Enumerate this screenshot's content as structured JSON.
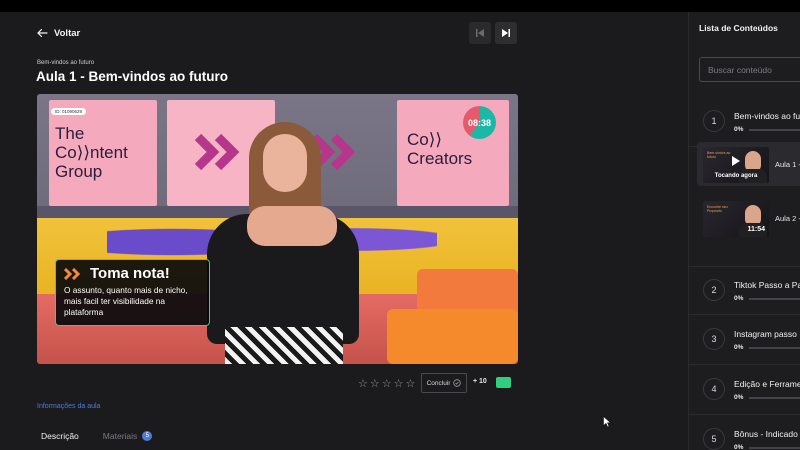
{
  "header": {
    "back_label": "Voltar",
    "breadcrumb": "Bem-vindos ao futuro",
    "title": "Aula 1 - Bem-vindos ao futuro"
  },
  "video": {
    "logo_left_line1": "The",
    "logo_left_line2": "Co⟩⟩ntent",
    "logo_left_line3": "Group",
    "logo_right_line1": "Co⟩⟩",
    "logo_right_line2": "Creators",
    "id_badge": "ID: 01090629",
    "timer": "08:38",
    "tip_title": "Toma nota!",
    "tip_body": "O assunto, quanto mais de nicho, mais facil ter visibilidade na plataforma"
  },
  "actions": {
    "conclude_label": "Concluir",
    "points": "+ 10",
    "rating_stars": 5
  },
  "info_link": "Informações da aula",
  "tabs": [
    {
      "label": "Descrição"
    },
    {
      "label": "Materiais",
      "count": "5"
    }
  ],
  "sidebar": {
    "title": "Lista de Conteúdos",
    "search_placeholder": "Buscar conteúdo",
    "modules": [
      {
        "num": "1",
        "name": "Bem-vindos ao fu",
        "pct": "0%"
      },
      {
        "num": "2",
        "name": "Tiktok Passo a Pa",
        "pct": "0%"
      },
      {
        "num": "3",
        "name": "Instagram passo",
        "pct": "0%"
      },
      {
        "num": "4",
        "name": "Edição e Ferrame",
        "pct": "0%"
      },
      {
        "num": "5",
        "name": "Bônus - Indicado",
        "pct": "0%"
      }
    ],
    "lessons": [
      {
        "name": "Aula 1 -",
        "thumb_label": "Tocando agora",
        "thumb_small": "Bem-vindos ao futuro",
        "current": true
      },
      {
        "name": "Aula 2 -",
        "thumb_duration": "11:54",
        "thumb_small": "Encontre seu Propósito",
        "current": false
      }
    ]
  },
  "colors": {
    "background": "#1b1b1d",
    "accent_link": "#4f7bd9",
    "tip_border": "#2fcf9e"
  }
}
